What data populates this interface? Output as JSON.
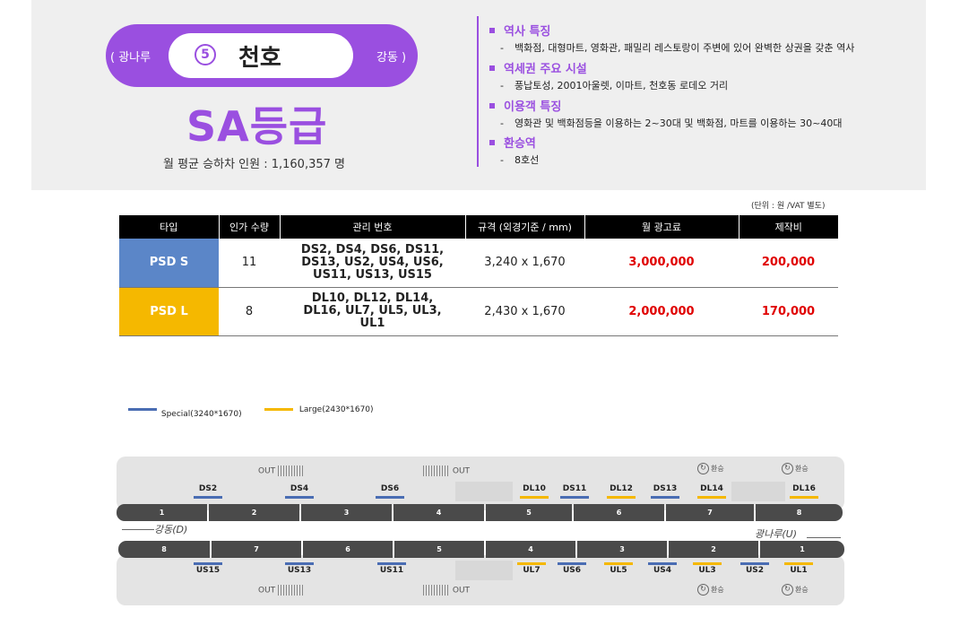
{
  "station": {
    "prev": "( 광나루",
    "next": "강동 )",
    "line_number": "5",
    "name": "천호",
    "grade": "SA등급",
    "ridership": "월 평균 승하차 인원 :  1,160,357 명"
  },
  "info": [
    {
      "title": "역사 특징",
      "desc": "백화점, 대형마트, 영화관, 패밀리 레스토랑이 주변에 있어 완벽한 상권을 갖춘 역사"
    },
    {
      "title": "역세권 주요 시설",
      "desc": "풍납토성, 2001아울렛, 이마트, 천호동 로데오 거리"
    },
    {
      "title": "이용객 특징",
      "desc": "영화관 및 백화점등을 이용하는 2~30대 및 백화점, 마트를 이용하는 30~40대"
    },
    {
      "title": "환승역",
      "desc": "8호선"
    }
  ],
  "unit_note": "(단위 : 원 /VAT 별도)",
  "table": {
    "headers": [
      "타입",
      "인가 수량",
      "관리 번호",
      "규격 (외경기준 / mm)",
      "월 광고료",
      "제작비"
    ],
    "rows": [
      {
        "type": "PSD S",
        "qty": "11",
        "ids": "DS2, DS4, DS6, DS11, DS13, US2, US4, US6, US11, US13, US15",
        "size": "3,240 x 1,670",
        "fee": "3,000,000",
        "cost": "200,000"
      },
      {
        "type": "PSD L",
        "qty": "8",
        "ids": "DL10, DL12, DL14, DL16, UL7, UL5, UL3, UL1",
        "size": "2,430 x 1,670",
        "fee": "2,000,000",
        "cost": "170,000"
      }
    ]
  },
  "legend": {
    "special": "Special(3240*1670)",
    "large": "Large(2430*1670)",
    "special_color": "#4a6db3",
    "large_color": "#f5b800"
  },
  "map": {
    "out_label": "OUT",
    "transfer_label": "환승",
    "transfer_icon": "transfer-icon",
    "dir_left": "강동(D)",
    "dir_right": "광나루(U)",
    "top_doors": [
      "DS2",
      "DS4",
      "DS6",
      "DL10",
      "DS11",
      "DL12",
      "DS13",
      "DL14",
      "DL16"
    ],
    "top_cars": [
      "1",
      "2",
      "3",
      "4",
      "5",
      "6",
      "7",
      "8"
    ],
    "bottom_cars": [
      "8",
      "7",
      "6",
      "5",
      "4",
      "3",
      "2",
      "1"
    ],
    "bottom_doors": [
      "US15",
      "US13",
      "US11",
      "UL7",
      "US6",
      "UL5",
      "US4",
      "UL3",
      "US2",
      "UL1"
    ]
  }
}
